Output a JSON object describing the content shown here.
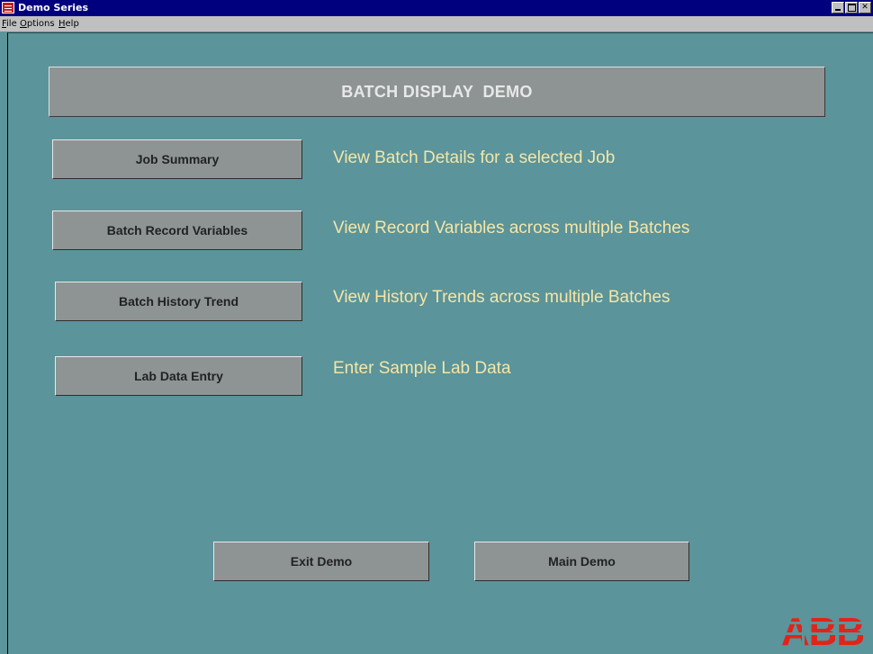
{
  "window": {
    "title": "Demo Series"
  },
  "menu": {
    "file": "File",
    "options": "Options",
    "help": "Help"
  },
  "header": {
    "title": "BATCH DISPLAY  DEMO"
  },
  "buttons": {
    "job_summary": "Job Summary",
    "batch_record_variables": "Batch Record Variables",
    "batch_history_trend": "Batch History Trend",
    "lab_data_entry": "Lab Data Entry",
    "exit_demo": "Exit Demo",
    "main_demo": "Main Demo"
  },
  "descriptions": {
    "job_summary": "View Batch Details for a selected Job",
    "batch_record_variables": "View Record Variables across multiple Batches",
    "batch_history_trend": "View History Trends across multiple Batches",
    "lab_data_entry": "Enter Sample Lab Data"
  },
  "logo": {
    "text": "ABB",
    "color": "#e2231a"
  },
  "colors": {
    "background": "#5b949a",
    "button": "#8e9494",
    "description_text": "#f5e6a8",
    "titlebar": "#00007f"
  }
}
